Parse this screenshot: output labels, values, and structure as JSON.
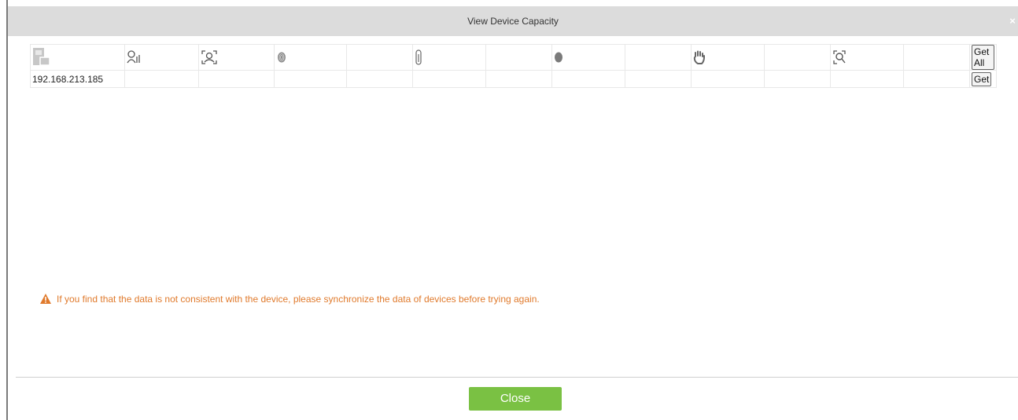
{
  "dialog": {
    "title": "View Device Capacity",
    "close_x": "×"
  },
  "table": {
    "header_icons": [
      "device-icon",
      "user-icon",
      "face-icon",
      "fingerprint-icon",
      "finger-vein-icon",
      "face-template-icon",
      "palm-icon",
      "visible-face-icon"
    ],
    "get_all_label": "Get All",
    "rows": [
      {
        "device": "192.168.213.185",
        "get_label": "Get"
      }
    ]
  },
  "warning": {
    "text": "If you find that the data is not consistent with the device, please synchronize the data of devices before trying again.",
    "color": "#e07a2c"
  },
  "footer": {
    "close_label": "Close",
    "close_color": "#7ac143"
  }
}
